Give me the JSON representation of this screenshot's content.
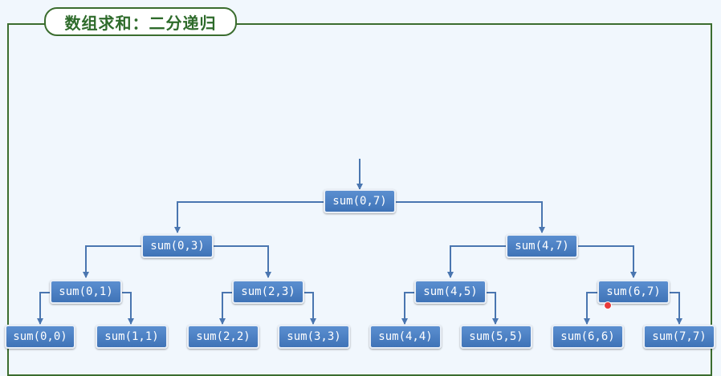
{
  "title": "数组求和：二分递归",
  "colors": {
    "frame": "#3b6d2f",
    "node": "#4a7ec2",
    "edge": "#4a76b0"
  },
  "nodes": {
    "n07": "sum(0,7)",
    "n03": "sum(0,3)",
    "n47": "sum(4,7)",
    "n01": "sum(0,1)",
    "n23": "sum(2,3)",
    "n45": "sum(4,5)",
    "n67": "sum(6,7)",
    "n00": "sum(0,0)",
    "n11": "sum(1,1)",
    "n22": "sum(2,2)",
    "n33": "sum(3,3)",
    "n44": "sum(4,4)",
    "n55": "sum(5,5)",
    "n66": "sum(6,6)",
    "n77": "sum(7,7)"
  }
}
